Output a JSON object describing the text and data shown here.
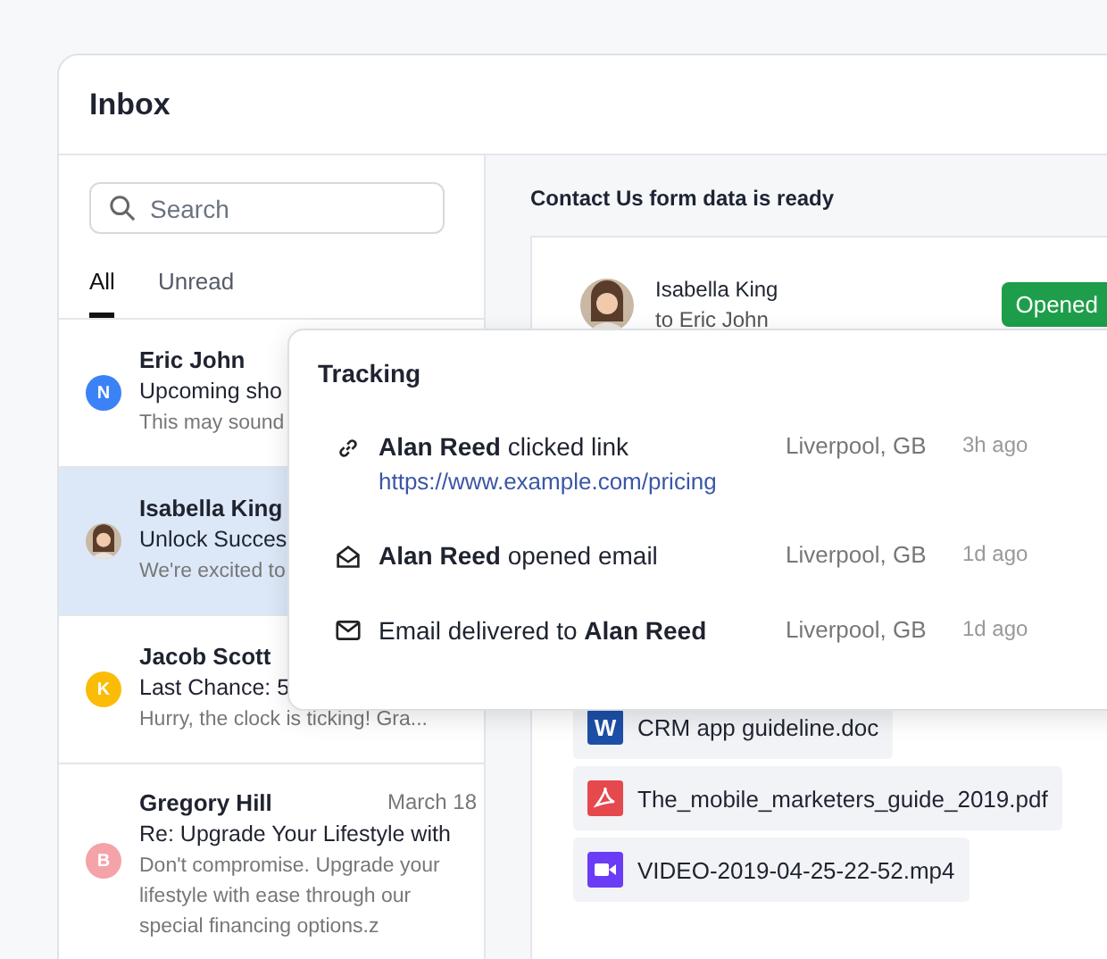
{
  "window": {
    "title": "Inbox"
  },
  "search": {
    "placeholder": "Search"
  },
  "tabs": [
    {
      "label": "All",
      "selected": true
    },
    {
      "label": "Unread",
      "selected": false
    }
  ],
  "messages": [
    {
      "sender": "Eric John",
      "avatar": {
        "kind": "initial",
        "letter": "N",
        "color": "#3b82f6"
      },
      "subject": "Upcoming sho",
      "preview": "This may sound",
      "selected": false
    },
    {
      "sender": "Isabella King",
      "subject": "Unlock Succes",
      "preview": "We're excited to",
      "selected": true
    },
    {
      "sender": "Jacob Scott",
      "avatar": {
        "kind": "initial",
        "letter": "K",
        "color": "#fbbc05"
      },
      "subject": "Last Chance: 5",
      "preview": "Hurry, the clock is ticking! Gra...",
      "selected": false
    },
    {
      "sender": "Gregory Hill",
      "date": "March 18",
      "avatar": {
        "kind": "initial",
        "letter": "B",
        "color": "#f4a3a8"
      },
      "subject": "Re: Upgrade Your Lifestyle with",
      "preview": "Don't compromise. Upgrade your lifestyle with ease through our special financing options.z",
      "selected": false
    }
  ],
  "detail": {
    "heading": "Contact Us form data is ready",
    "sender": "Isabella King",
    "recipient": "to Eric John",
    "status": "Opened",
    "attachments": [
      {
        "kind": "doc",
        "badge": "W",
        "name": "CRM app guideline.doc"
      },
      {
        "kind": "pdf",
        "name": "The_mobile_marketers_guide_2019.pdf"
      },
      {
        "kind": "video",
        "name": "VIDEO-2019-04-25-22-52.mp4"
      }
    ]
  },
  "tracking": {
    "title": "Tracking",
    "events": [
      {
        "kind": "link",
        "text": "**Alan Reed** clicked link",
        "url": "https://www.example.com/pricing",
        "location": "Liverpool, GB",
        "time": "3h ago"
      },
      {
        "kind": "opened",
        "text": "**Alan Reed** opened email",
        "location": "Liverpool, GB",
        "time": "1d ago"
      },
      {
        "kind": "delivered",
        "text": "Email delivered to **Alan Reed**",
        "location": "Liverpool, GB",
        "time": "1d ago"
      }
    ]
  }
}
